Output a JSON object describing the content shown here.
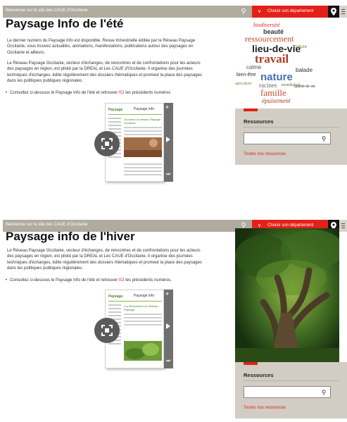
{
  "site": {
    "welcome": "Bienvenue sur le site des CAUE d'Occitanie",
    "department_label": "Choisir son département"
  },
  "panel1": {
    "title": "Paysage Info de l'été",
    "para1": "Le dernier numéro du Paysage info est disponible. Revue trimestrielle éditée par le Réseau Paysage Occitanie, vous trouvez actualités, animations, manifestations, publications autour des paysages en Occitanie et ailleurs.",
    "para2_part1": "Le Réseau Paysage Occitanie, vecteur d'échanges, de rencontres et de confrontations pour les acteurs des paysages en région, est piloté par la DREAL et ",
    "para2_emph": "Les CAUE d'Occitanie",
    "para2_part2": ". Il organise des journées techniques d'échanges, édite régulièrement des dossiers thématiques et promeut la place des paysages dans les politiques publiques régionales.",
    "bullet_before": "Consultez ci-dessous le Paysage Info de l'été et retrouver ",
    "bullet_link": "ICI",
    "bullet_after": " les précédents numéros",
    "viewer": {
      "brand": "Paysage",
      "page_title": "Paysage Info",
      "headline": "Journées du réseau Paysage Occitanie"
    },
    "wordcloud_words": [
      "biodiversité",
      "beauté",
      "ressourcement",
      "lieu-de-vie",
      "travail",
      "calme",
      "balade",
      "nature",
      "bien-être",
      "racines",
      "famille",
      "épuisement",
      "agriculture",
      "qualité-de-vie",
      "mondialisé",
      "culture"
    ],
    "resources_title": "Ressources",
    "resources_placeholder": "",
    "resources_link": "Toutes nos ressources"
  },
  "panel2": {
    "title": "Paysage info de l'hiver",
    "para1": "Le Réseau Paysage Occitanie, vecteur d'échanges, de rencontres et de confrontations pour les acteurs des paysages en région, est piloté par la DREAL et Les CAUE d'Occitanie. Il organise des journées techniques d'échanges, édite régulièrement des dossiers thématiques et promeut la place des paysages dans les politiques publiques régionales.",
    "bullet_before": "Consultez ci-dessous le Paysage Info de l'été et retrouver ",
    "bullet_link": "ICI",
    "bullet_after": " les précédents numéros.",
    "viewer": {
      "brand": "Paysage",
      "page_title": "Paysage Info",
      "headline": "Les Rencontres du Réseau Paysage"
    },
    "resources_title": "Ressources",
    "resources_placeholder": "",
    "resources_link": "Toutes nos ressources"
  },
  "colors": {
    "topbar": "#b0ab9f",
    "accent_red": "#e32119",
    "resources_bg": "#d1cdc5",
    "leaf_green": "#8bb84b"
  }
}
